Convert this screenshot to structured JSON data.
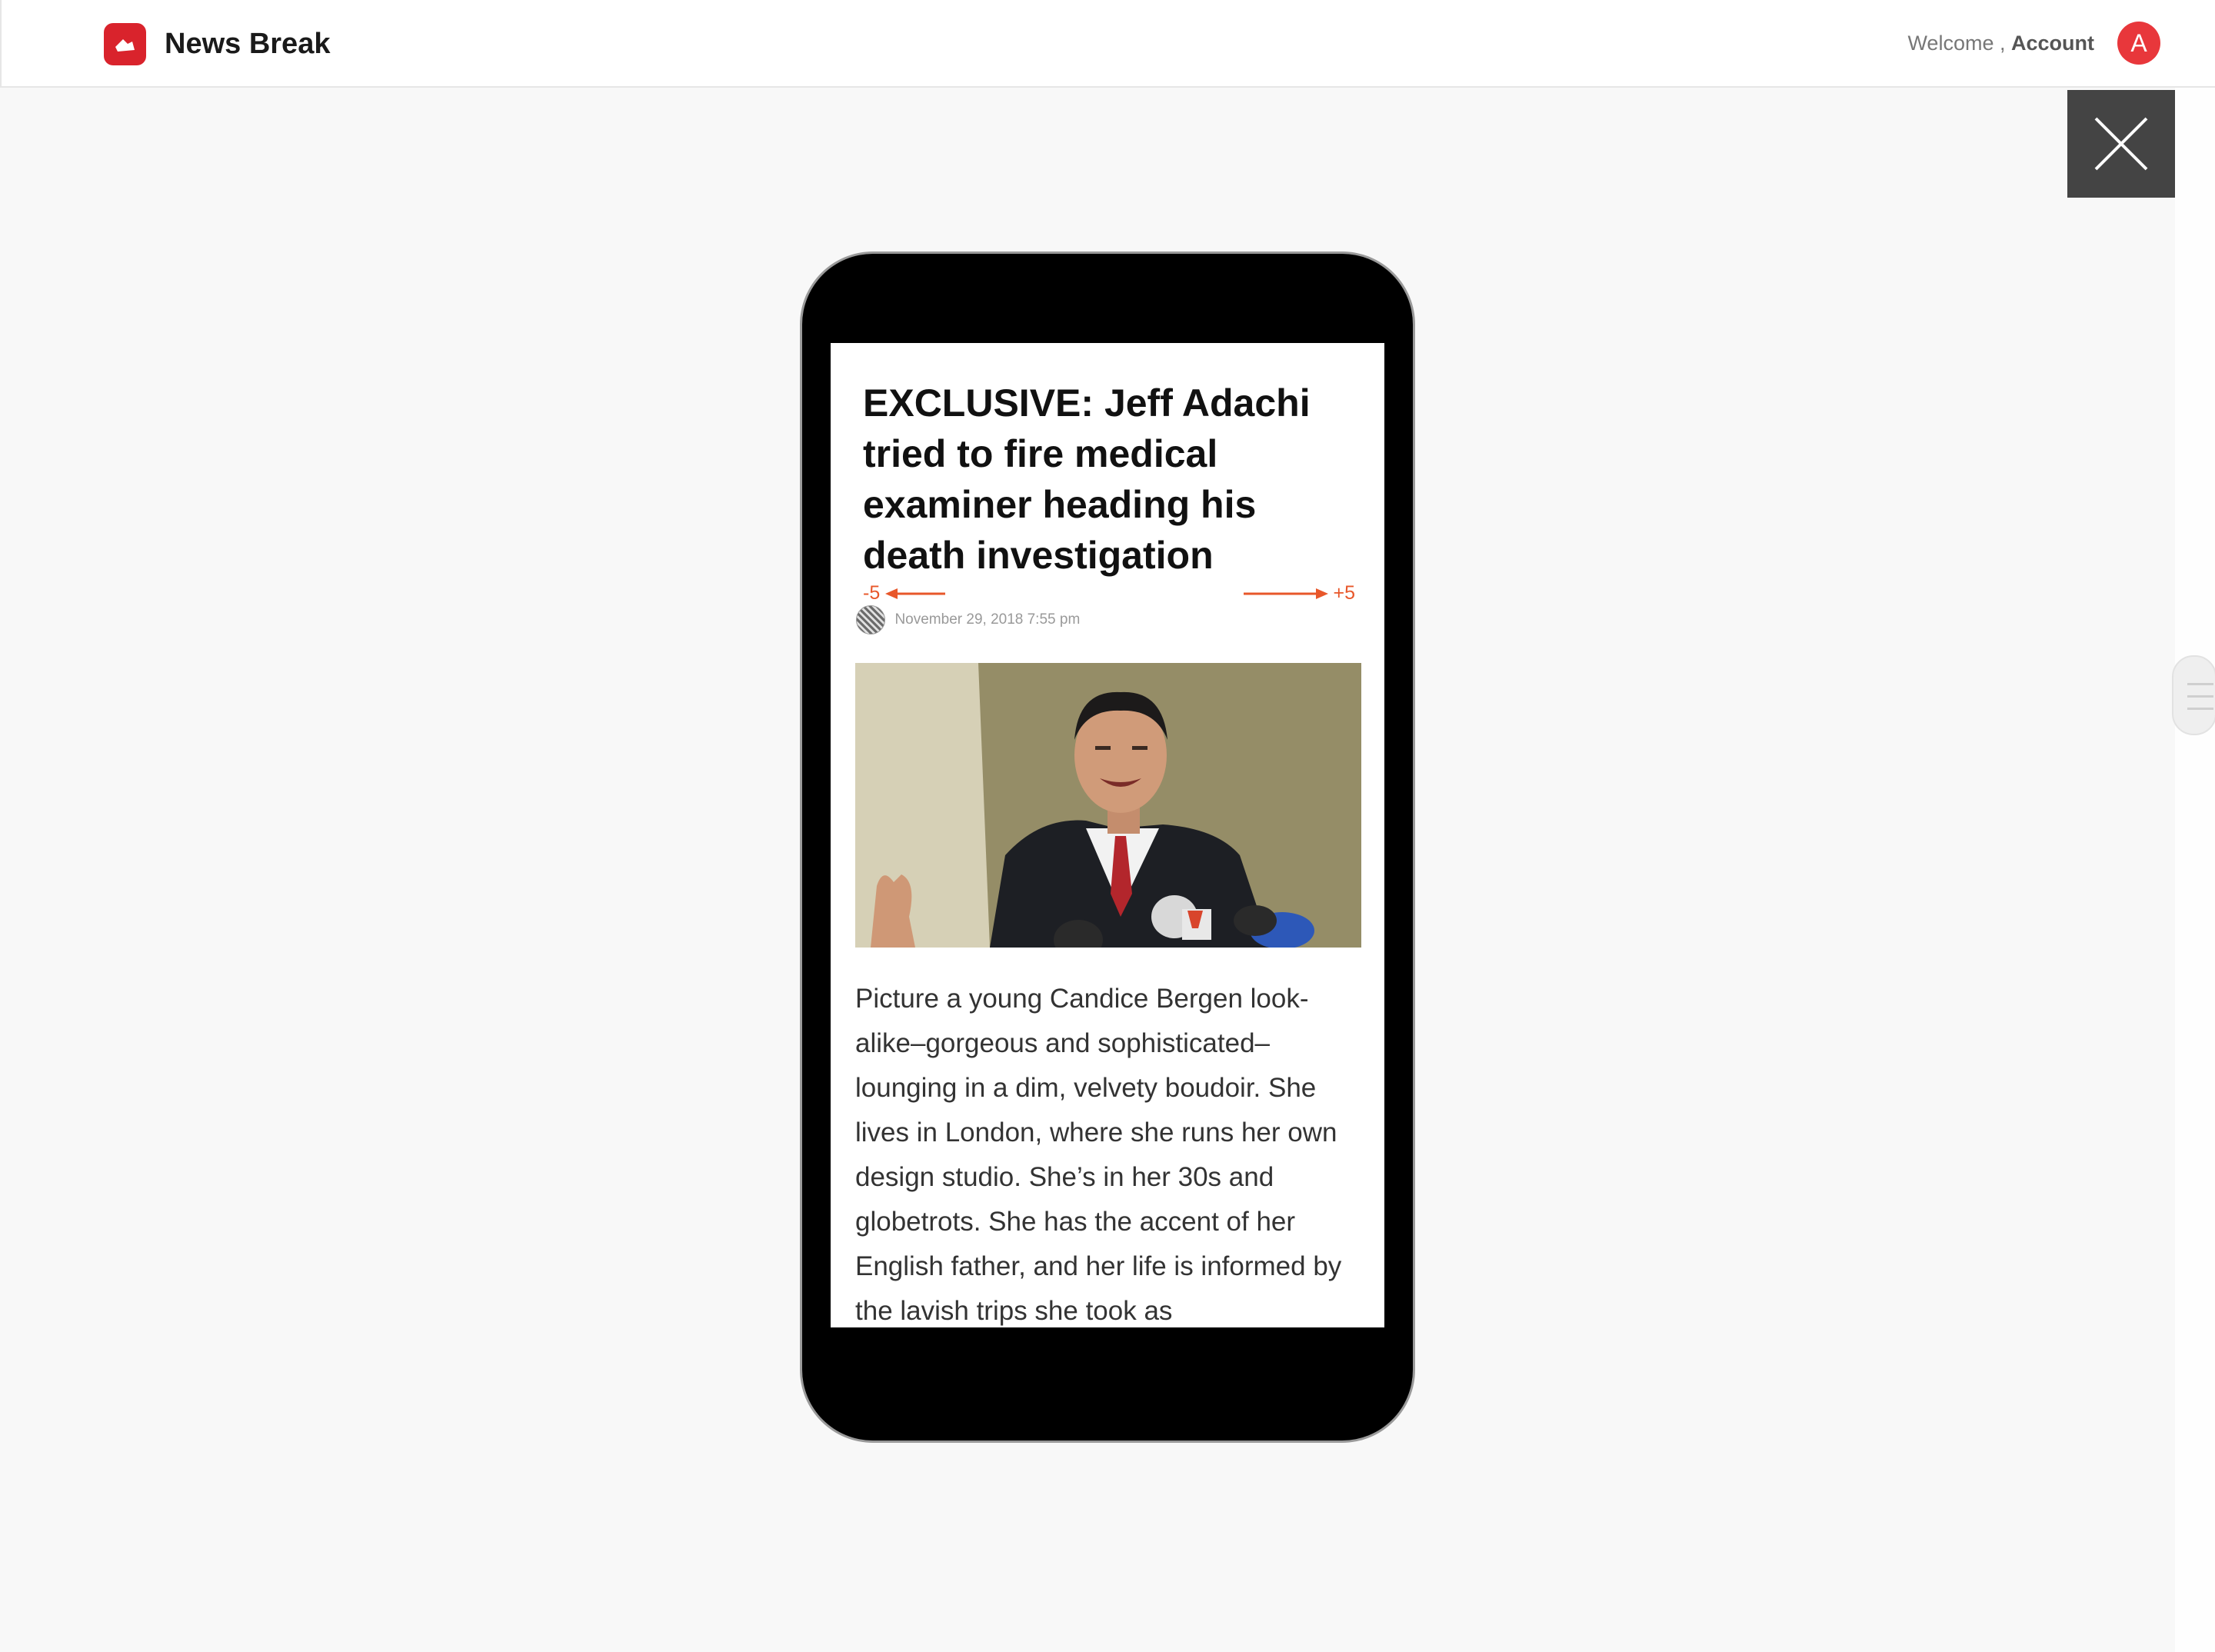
{
  "header": {
    "brand": "News Break",
    "welcome": "Welcome ,",
    "account": "Account",
    "avatar_initial": "A",
    "logo_icon": "newsbreak-logo-icon",
    "brand_color": "#d9232c"
  },
  "overlay": {
    "close_icon": "close-icon"
  },
  "article": {
    "headline": "EXCLUSIVE: Jeff Adachi tried to fire medical examiner heading his death investigation",
    "swipe_left": "-5",
    "swipe_right": "+5",
    "date": "November 29, 2018 7:55 pm",
    "body": "Picture a young Candice Bergen look-alike–gorgeous and sophisticated–lounging in a dim, velvety boudoir. She lives in London, where she runs her own design studio. She’s in her 30s and globetrots. She has the accent of her English father, and her life is informed by the lavish trips she took as"
  },
  "colors": {
    "accent": "#e8572a",
    "avatar_bg": "#e8373b",
    "close_bg": "#444444"
  }
}
